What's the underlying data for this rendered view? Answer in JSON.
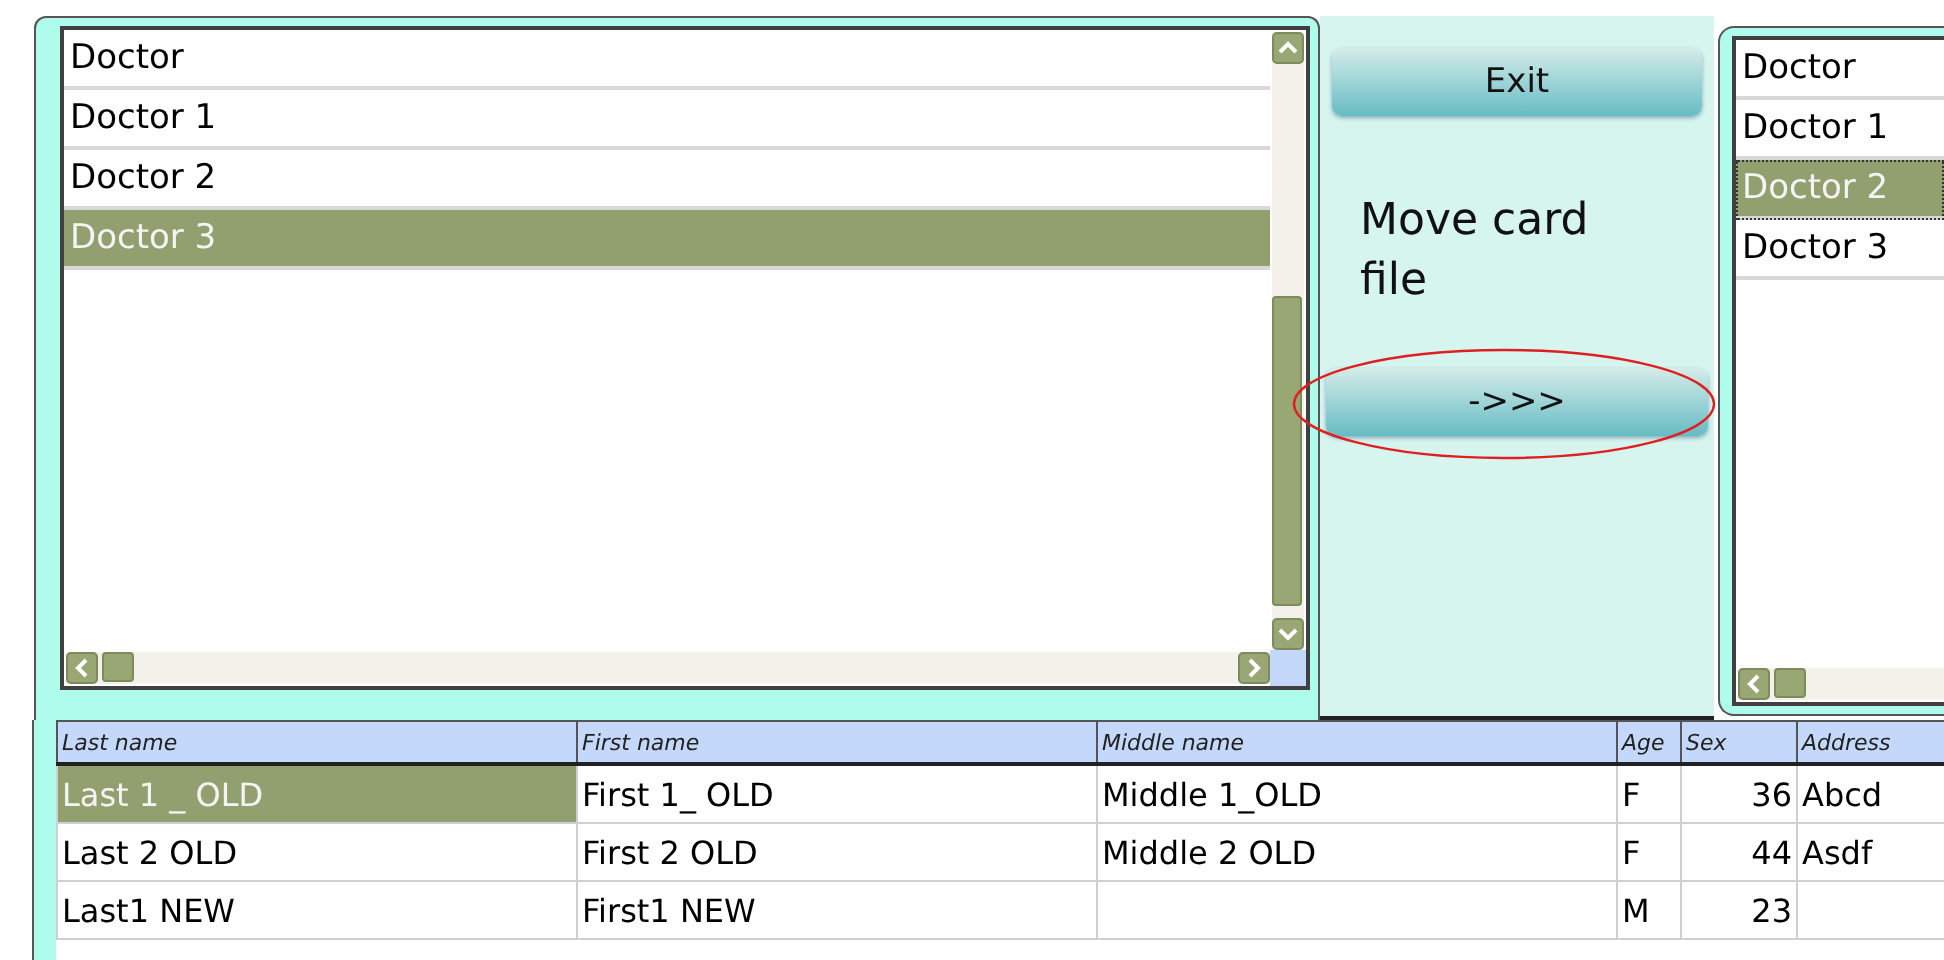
{
  "source_list": {
    "items": [
      {
        "label": "Doctor",
        "selected": false
      },
      {
        "label": "Doctor 1",
        "selected": false
      },
      {
        "label": "Doctor 2",
        "selected": false
      },
      {
        "label": "Doctor 3",
        "selected": true
      }
    ]
  },
  "actions": {
    "exit_button": "Exit",
    "caption": "Move card file",
    "move_button": "->>>"
  },
  "target_list": {
    "items": [
      {
        "label": "Doctor",
        "selected": false
      },
      {
        "label": "Doctor 1",
        "selected": false
      },
      {
        "label": "Doctor 2",
        "selected": true
      },
      {
        "label": "Doctor 3",
        "selected": false
      }
    ]
  },
  "table": {
    "columns": [
      "Last name",
      "First name",
      "Middle name",
      "Age",
      "Sex",
      "Address"
    ],
    "rows": [
      {
        "cells": [
          "Last 1 _ OLD",
          "First 1_ OLD",
          "Middle 1_OLD",
          "F",
          "36",
          "Abcd"
        ],
        "selected": true
      },
      {
        "cells": [
          "Last 2 OLD",
          "First 2 OLD",
          "Middle 2 OLD",
          "F",
          "44",
          "Asdf"
        ],
        "selected": false
      },
      {
        "cells": [
          "Last1 NEW",
          "First1 NEW",
          "",
          "M",
          "23",
          ""
        ],
        "selected": false
      }
    ]
  }
}
